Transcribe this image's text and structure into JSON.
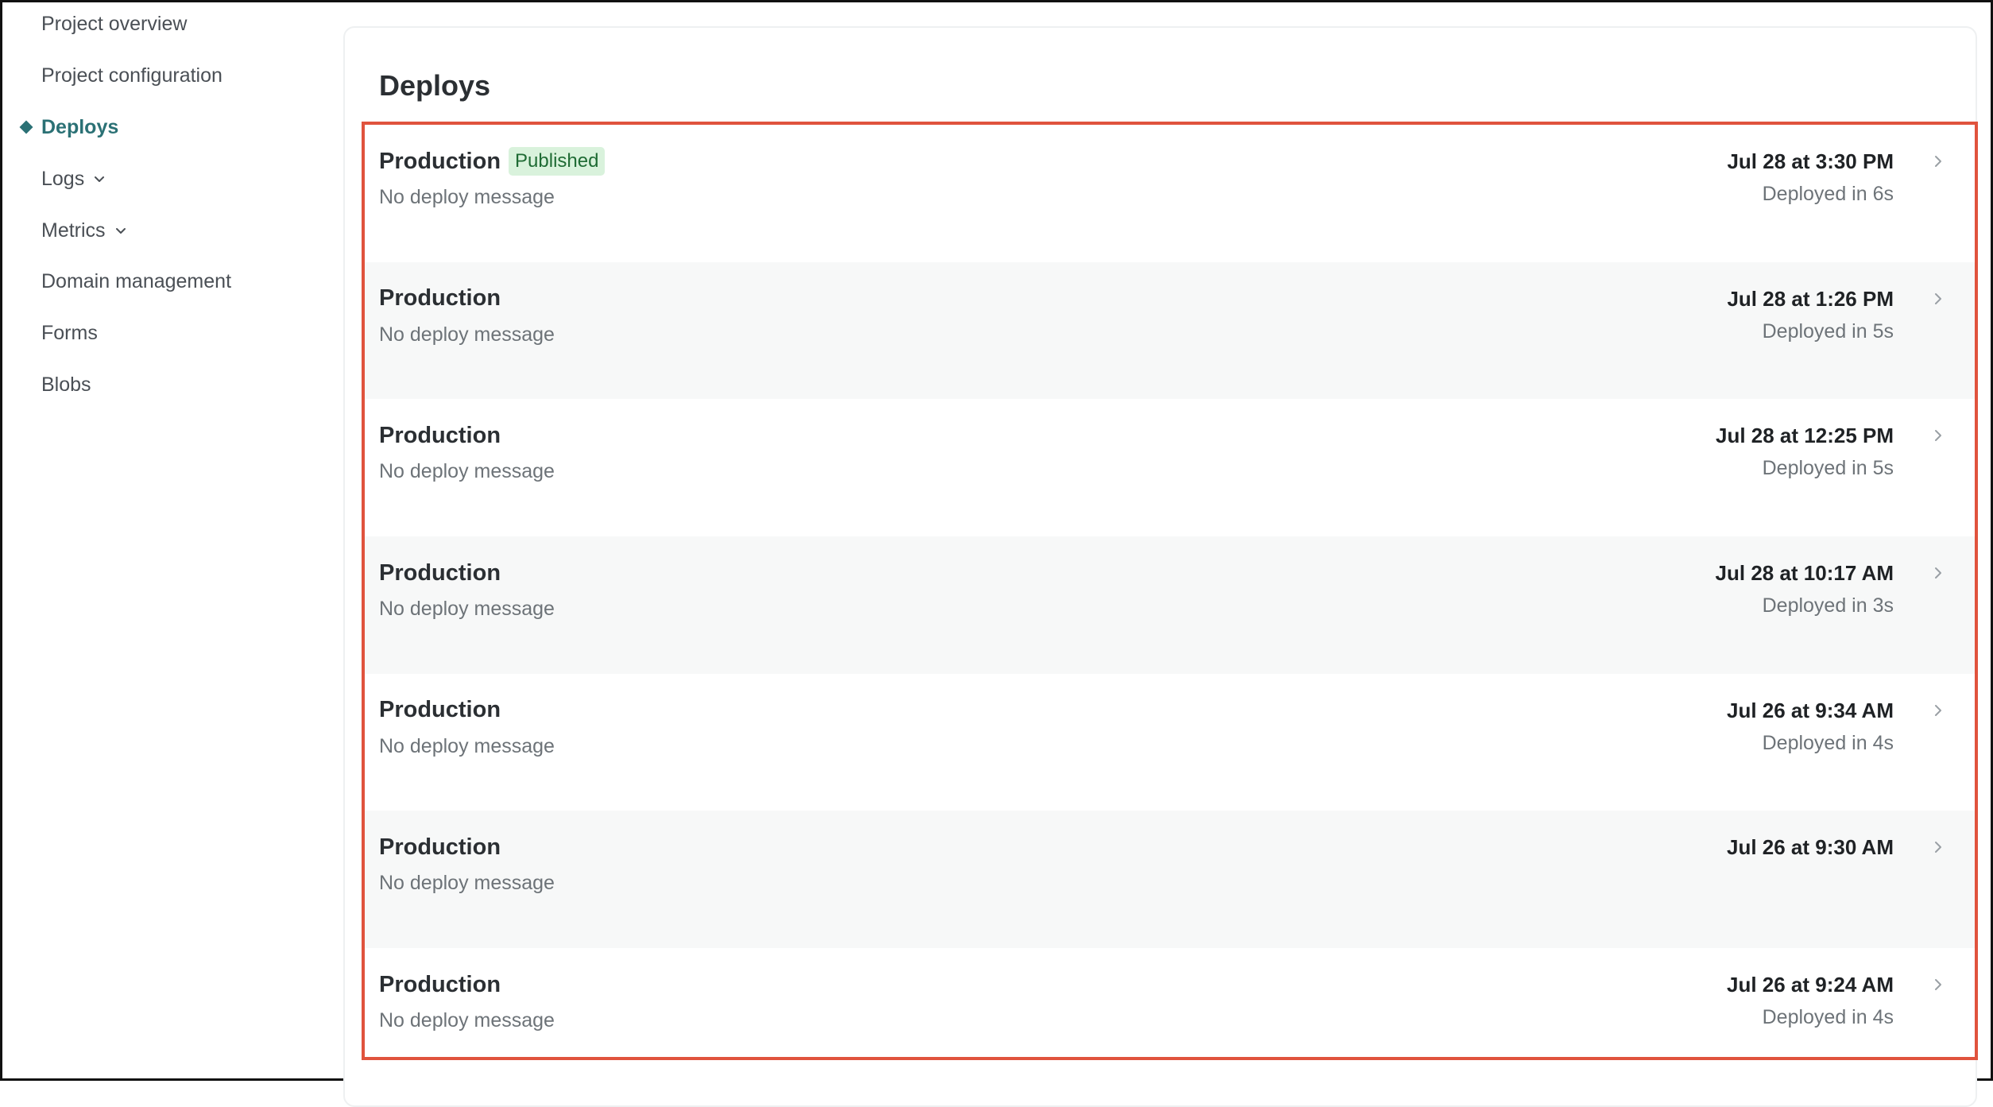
{
  "sidebar": {
    "items": [
      {
        "label": "Project overview",
        "active": false,
        "has_dropdown": false
      },
      {
        "label": "Project configuration",
        "active": false,
        "has_dropdown": false
      },
      {
        "label": "Deploys",
        "active": true,
        "has_dropdown": false
      },
      {
        "label": "Logs",
        "active": false,
        "has_dropdown": true
      },
      {
        "label": "Metrics",
        "active": false,
        "has_dropdown": true
      },
      {
        "label": "Domain management",
        "active": false,
        "has_dropdown": false
      },
      {
        "label": "Forms",
        "active": false,
        "has_dropdown": false
      },
      {
        "label": "Blobs",
        "active": false,
        "has_dropdown": false
      }
    ]
  },
  "main": {
    "title": "Deploys",
    "deploys": [
      {
        "env": "Production",
        "badge": "Published",
        "message": "No deploy message",
        "date": "Jul 28 at 3:30 PM",
        "duration": "Deployed in 6s"
      },
      {
        "env": "Production",
        "badge": "",
        "message": "No deploy message",
        "date": "Jul 28 at 1:26 PM",
        "duration": "Deployed in 5s"
      },
      {
        "env": "Production",
        "badge": "",
        "message": "No deploy message",
        "date": "Jul 28 at 12:25 PM",
        "duration": "Deployed in 5s"
      },
      {
        "env": "Production",
        "badge": "",
        "message": "No deploy message",
        "date": "Jul 28 at 10:17 AM",
        "duration": "Deployed in 3s"
      },
      {
        "env": "Production",
        "badge": "",
        "message": "No deploy message",
        "date": "Jul 26 at 9:34 AM",
        "duration": "Deployed in 4s"
      },
      {
        "env": "Production",
        "badge": "",
        "message": "No deploy message",
        "date": "Jul 26 at 9:30 AM",
        "duration": ""
      },
      {
        "env": "Production",
        "badge": "",
        "message": "No deploy message",
        "date": "Jul 26 at 9:24 AM",
        "duration": "Deployed in 4s"
      }
    ]
  },
  "colors": {
    "accent": "#2b7175",
    "highlight_border": "#e0533d",
    "badge_bg": "#d9f2dc",
    "badge_text": "#1f6b34",
    "row_alt": "#f7f8f8"
  },
  "icons": {
    "nav_dropdown": "chevron-down-icon",
    "row_arrow": "chevron-right-icon",
    "active_marker": "diamond-icon"
  }
}
